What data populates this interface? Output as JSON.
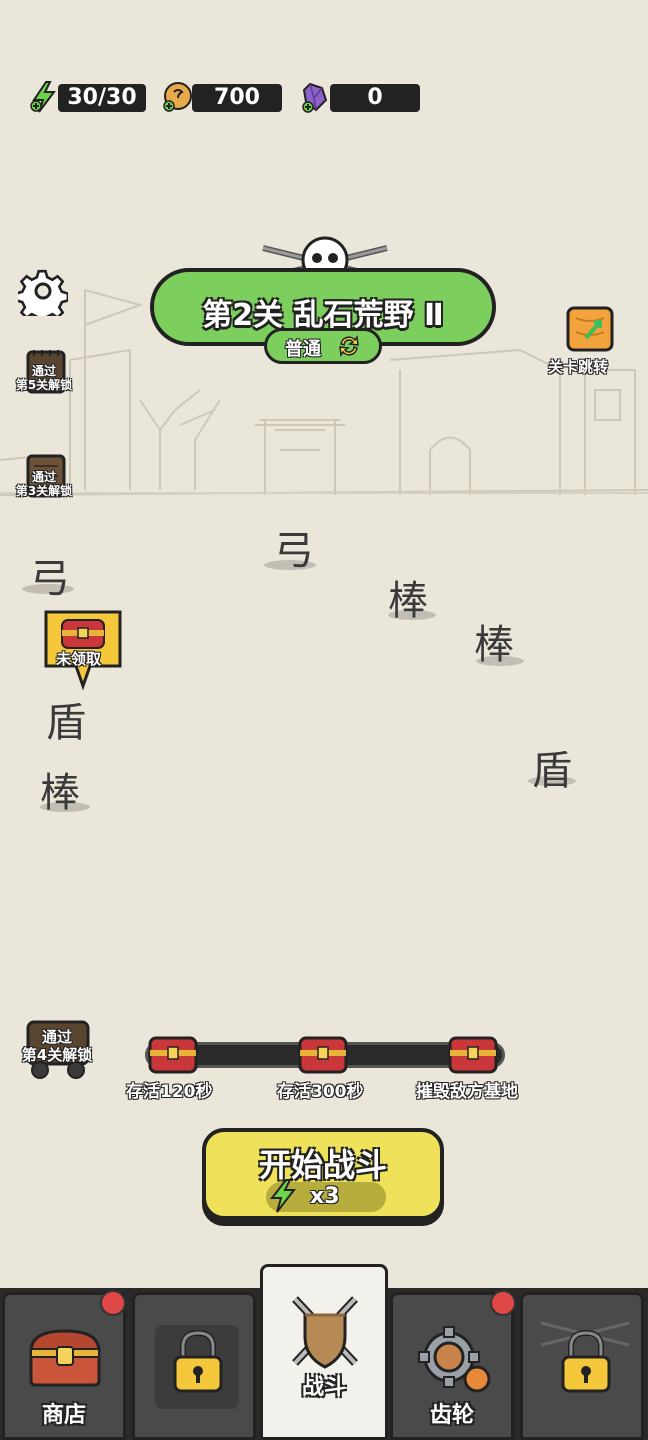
{
  "resources": {
    "energy": "30/30",
    "coins": "700",
    "gems": "0"
  },
  "stage": {
    "title": "第2关 乱石荒野 Ⅱ",
    "mode": "普通"
  },
  "side": {
    "level_jump": "关卡跳转",
    "unlock5": "通过\n第5关解锁",
    "unlock3": "通过\n第3关解锁",
    "unclaimed": "未领取",
    "unlock4": "通过\n第4关解锁"
  },
  "units": [
    {
      "char": "弓"
    },
    {
      "char": "弓"
    },
    {
      "char": "棒"
    },
    {
      "char": "棒"
    },
    {
      "char": "盾"
    },
    {
      "char": "盾"
    },
    {
      "char": "棒"
    }
  ],
  "goals": [
    "存活120秒",
    "存活300秒",
    "摧毁敌方基地"
  ],
  "start_button": {
    "label": "开始战斗",
    "cost": "x3"
  },
  "nav": {
    "shop": "商店",
    "battle": "战斗",
    "gear": "齿轮"
  },
  "colors": {
    "green": "#7ccf5c",
    "yellow": "#efe25a",
    "red_dot": "#e04848"
  }
}
